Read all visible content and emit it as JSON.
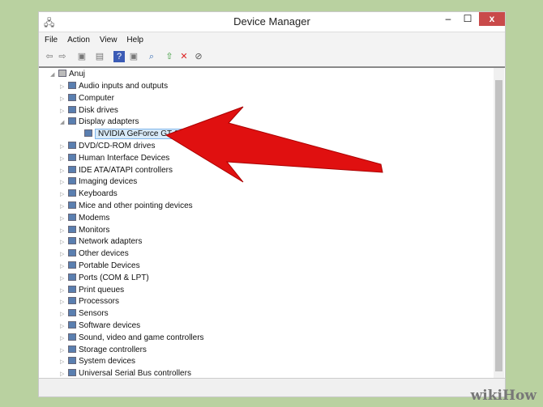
{
  "window": {
    "title": "Device Manager",
    "close": "x",
    "minimize": "–",
    "maximize": "☐"
  },
  "menu": [
    "File",
    "Action",
    "View",
    "Help"
  ],
  "toolbar": [
    "back-icon",
    "forward-icon",
    "properties-icon",
    "show-hide-icon",
    "help-icon",
    "view-icon",
    "scan-icon",
    "update-driver-icon",
    "uninstall-icon",
    "disable-icon"
  ],
  "tree": {
    "root": "Anuj",
    "items": [
      {
        "label": "Audio inputs and outputs"
      },
      {
        "label": "Computer"
      },
      {
        "label": "Disk drives"
      },
      {
        "label": "Display adapters",
        "expanded": true
      },
      {
        "label": "NVIDIA GeForce GT 610",
        "child": true,
        "selected": true
      },
      {
        "label": "DVD/CD-ROM drives"
      },
      {
        "label": "Human Interface Devices"
      },
      {
        "label": "IDE ATA/ATAPI controllers"
      },
      {
        "label": "Imaging devices"
      },
      {
        "label": "Keyboards"
      },
      {
        "label": "Mice and other pointing devices"
      },
      {
        "label": "Modems"
      },
      {
        "label": "Monitors"
      },
      {
        "label": "Network adapters"
      },
      {
        "label": "Other devices"
      },
      {
        "label": "Portable Devices"
      },
      {
        "label": "Ports (COM & LPT)"
      },
      {
        "label": "Print queues"
      },
      {
        "label": "Processors"
      },
      {
        "label": "Sensors"
      },
      {
        "label": "Software devices"
      },
      {
        "label": "Sound, video and game controllers"
      },
      {
        "label": "Storage controllers"
      },
      {
        "label": "System devices"
      },
      {
        "label": "Universal Serial Bus controllers"
      }
    ]
  },
  "watermark": "wikiHow",
  "colors": {
    "arrow": "#e01010",
    "close": "#c94a4a",
    "background": "#b9d1a0"
  }
}
